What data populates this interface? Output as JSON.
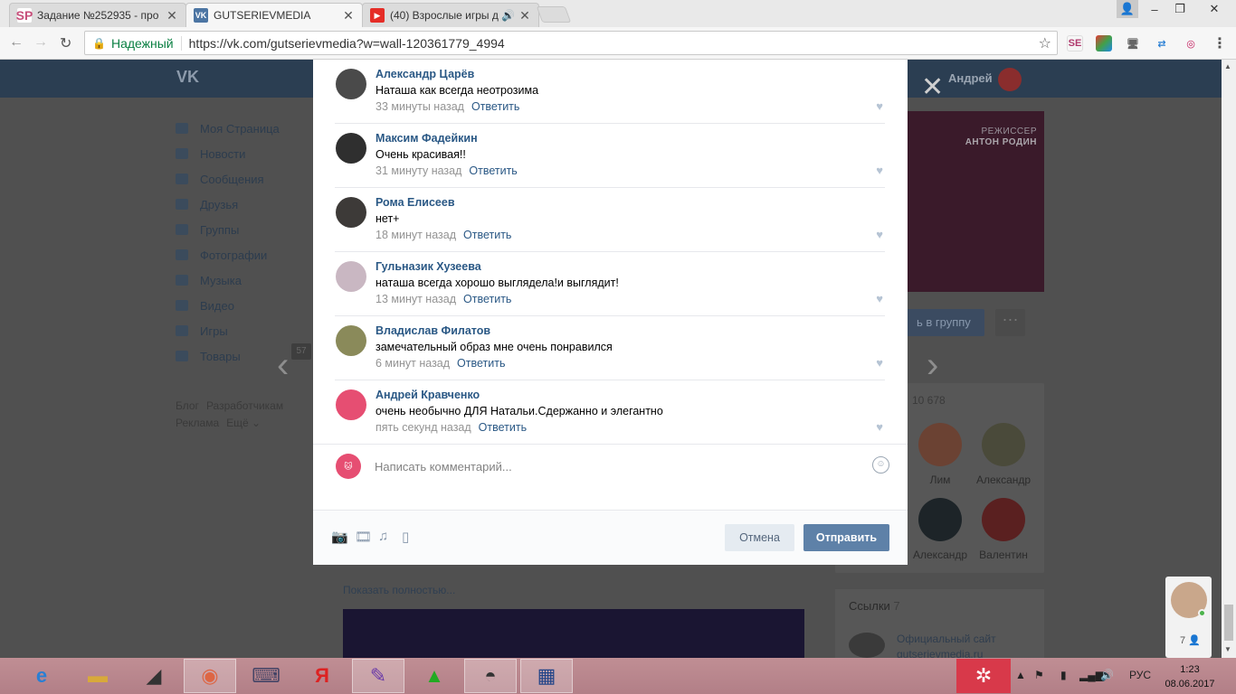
{
  "browser": {
    "tabs": [
      {
        "favicon": "SP",
        "title": "Задание №252935 - про",
        "close": "✕"
      },
      {
        "favicon": "VK",
        "title": "GUTSERIEVMEDIA",
        "close": "✕"
      },
      {
        "favicon": "▶",
        "title": "(40) Взрослые игры д",
        "close": "✕"
      }
    ],
    "secure_label": "Надежный",
    "url": "https://vk.com/gutserievmedia?w=wall-120361779_4994",
    "extensions": [
      "SE",
      "cube",
      "monitor",
      "p2p",
      "ring"
    ]
  },
  "vk": {
    "user_name": "Андрей",
    "menu": [
      "Моя Страница",
      "Новости",
      "Сообщения",
      "Друзья",
      "Группы",
      "Фотографии",
      "Музыка",
      "Видео",
      "Игры",
      "Товары"
    ],
    "menu_count_badge": "57",
    "footer_links": [
      "Блог",
      "Разработчикам",
      "Реклама",
      "Ещё ⌄"
    ],
    "poster_line1": "РЕЖИССЕР",
    "poster_line2": "АНТОН РОДИН",
    "join_label": "ь в группу",
    "more_label": "···",
    "members_count": "10 678",
    "members": [
      "Лим",
      "Александр",
      "Александр",
      "Валентин"
    ],
    "links_title": "Ссылки",
    "links_count": "7",
    "link_text_1": "Официальный сайт",
    "link_text_2": "gutserievmedia.ru",
    "show_all": "Показать полностью..."
  },
  "modal": {
    "comments": [
      {
        "name": "Александр Царёв",
        "text": "Наташа как всегда неотрозима",
        "time": "33 минуты назад",
        "reply": "Ответить",
        "avatar_color": "#4a4a4a"
      },
      {
        "name": "Максим Фадейкин",
        "text": "Очень красивая!!",
        "time": "31 минуту назад",
        "reply": "Ответить",
        "avatar_color": "#2f2f2f"
      },
      {
        "name": "Рома Елисеев",
        "text": "нет+",
        "time": "18 минут назад",
        "reply": "Ответить",
        "avatar_color": "#3d3a38"
      },
      {
        "name": "Гульназик Хузеева",
        "text": "наташа всегда хорошо выглядела!и выглядит!",
        "time": "13 минут назад",
        "reply": "Ответить",
        "avatar_color": "#c9b7c2"
      },
      {
        "name": "Владислав Филатов",
        "text": "замечательный образ мне очень понравился",
        "time": "6 минут назад",
        "reply": "Ответить",
        "avatar_color": "#8a8a5a"
      },
      {
        "name": "Андрей Кравченко",
        "text": "очень необычно ДЛЯ Натальи.Сдержанно и элегантно",
        "time": "пять секунд назад",
        "reply": "Ответить",
        "avatar_color": "#e64e72"
      }
    ],
    "comment_placeholder": "Написать комментарий...",
    "cancel_label": "Отмена",
    "send_label": "Отправить"
  },
  "chat": {
    "count": "7"
  },
  "taskbar": {
    "lang": "РУС",
    "time": "1:23",
    "date": "08.06.2017"
  }
}
